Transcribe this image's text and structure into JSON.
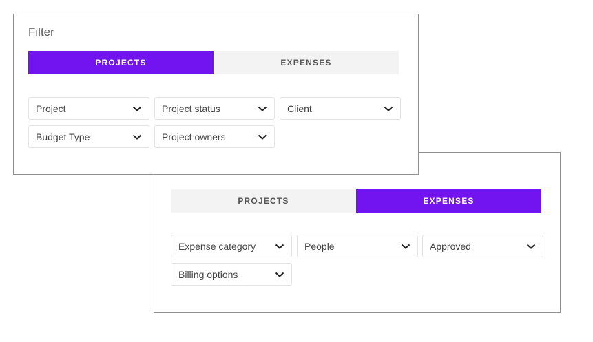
{
  "panel_a": {
    "title": "Filter",
    "tabs": [
      {
        "label": "PROJECTS",
        "active": true
      },
      {
        "label": "EXPENSES",
        "active": false
      }
    ],
    "dropdowns": [
      "Project",
      "Project status",
      "Client",
      "Budget Type",
      "Project owners"
    ]
  },
  "panel_b": {
    "tabs": [
      {
        "label": "PROJECTS",
        "active": false
      },
      {
        "label": "EXPENSES",
        "active": true
      }
    ],
    "dropdowns": [
      "Expense category",
      "People",
      "Approved",
      "Billing options"
    ]
  },
  "icons": {
    "dropdown": "chevron-down-icon"
  },
  "colors": {
    "accent": "#7214ef",
    "tab_inactive": "#f3f3f3",
    "border": "#8f8f8f"
  }
}
